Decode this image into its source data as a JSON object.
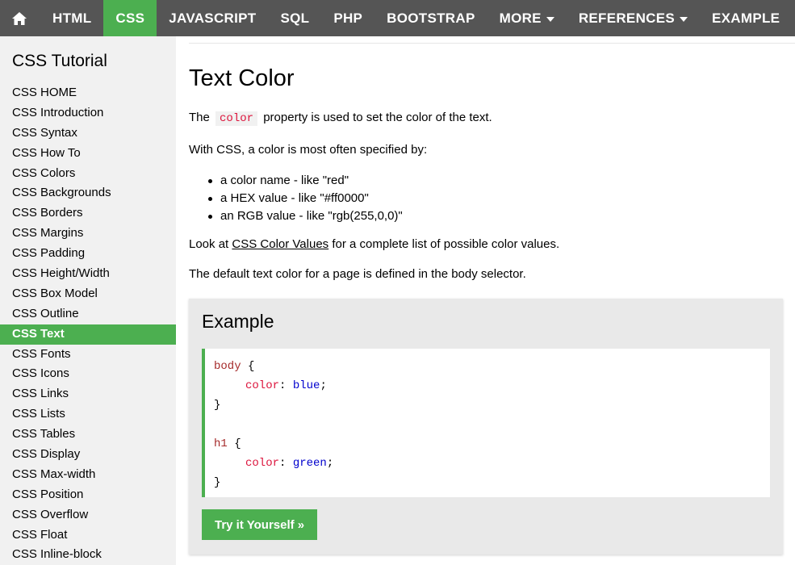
{
  "topnav": {
    "home_icon": "home-icon",
    "items": [
      "HTML",
      "CSS",
      "JAVASCRIPT",
      "SQL",
      "PHP",
      "BOOTSTRAP",
      "MORE",
      "REFERENCES",
      "EXAMPLE"
    ],
    "active": "CSS"
  },
  "sidebar": {
    "title": "CSS Tutorial",
    "active": "CSS Text",
    "items": [
      "CSS HOME",
      "CSS Introduction",
      "CSS Syntax",
      "CSS How To",
      "CSS Colors",
      "CSS Backgrounds",
      "CSS Borders",
      "CSS Margins",
      "CSS Padding",
      "CSS Height/Width",
      "CSS Box Model",
      "CSS Outline",
      "CSS Text",
      "CSS Fonts",
      "CSS Icons",
      "CSS Links",
      "CSS Lists",
      "CSS Tables",
      "CSS Display",
      "CSS Max-width",
      "CSS Position",
      "CSS Overflow",
      "CSS Float",
      "CSS Inline-block"
    ]
  },
  "main": {
    "title": "Text Color",
    "p1_before": "The",
    "p1_code": "color",
    "p1_after": "property is used to set the color of the text.",
    "p2": "With CSS, a color is most often specified by:",
    "bullets": [
      "a color name - like \"red\"",
      "a HEX value - like \"#ff0000\"",
      "an RGB value - like \"rgb(255,0,0)\""
    ],
    "p3_before": "Look at",
    "p3_link": "CSS Color Values",
    "p3_after": "for a complete list of possible color values.",
    "p4": "The default text color for a page is defined in the body selector."
  },
  "example": {
    "title": "Example",
    "code": {
      "sel1": "body",
      "prop1": "color",
      "val1": "blue",
      "sel2": "h1",
      "prop2": "color",
      "val2": "green",
      "open": "{",
      "close": "}",
      "colon": ":",
      "semi": ";"
    },
    "try_label": "Try it Yourself »"
  },
  "colors": {
    "accent": "#4CAF50",
    "nav_bg": "#555555",
    "sidebar_bg": "#f1f1f1",
    "code_selector": "#a52a2a",
    "code_property": "#dc143c",
    "code_value": "#0000cd"
  }
}
